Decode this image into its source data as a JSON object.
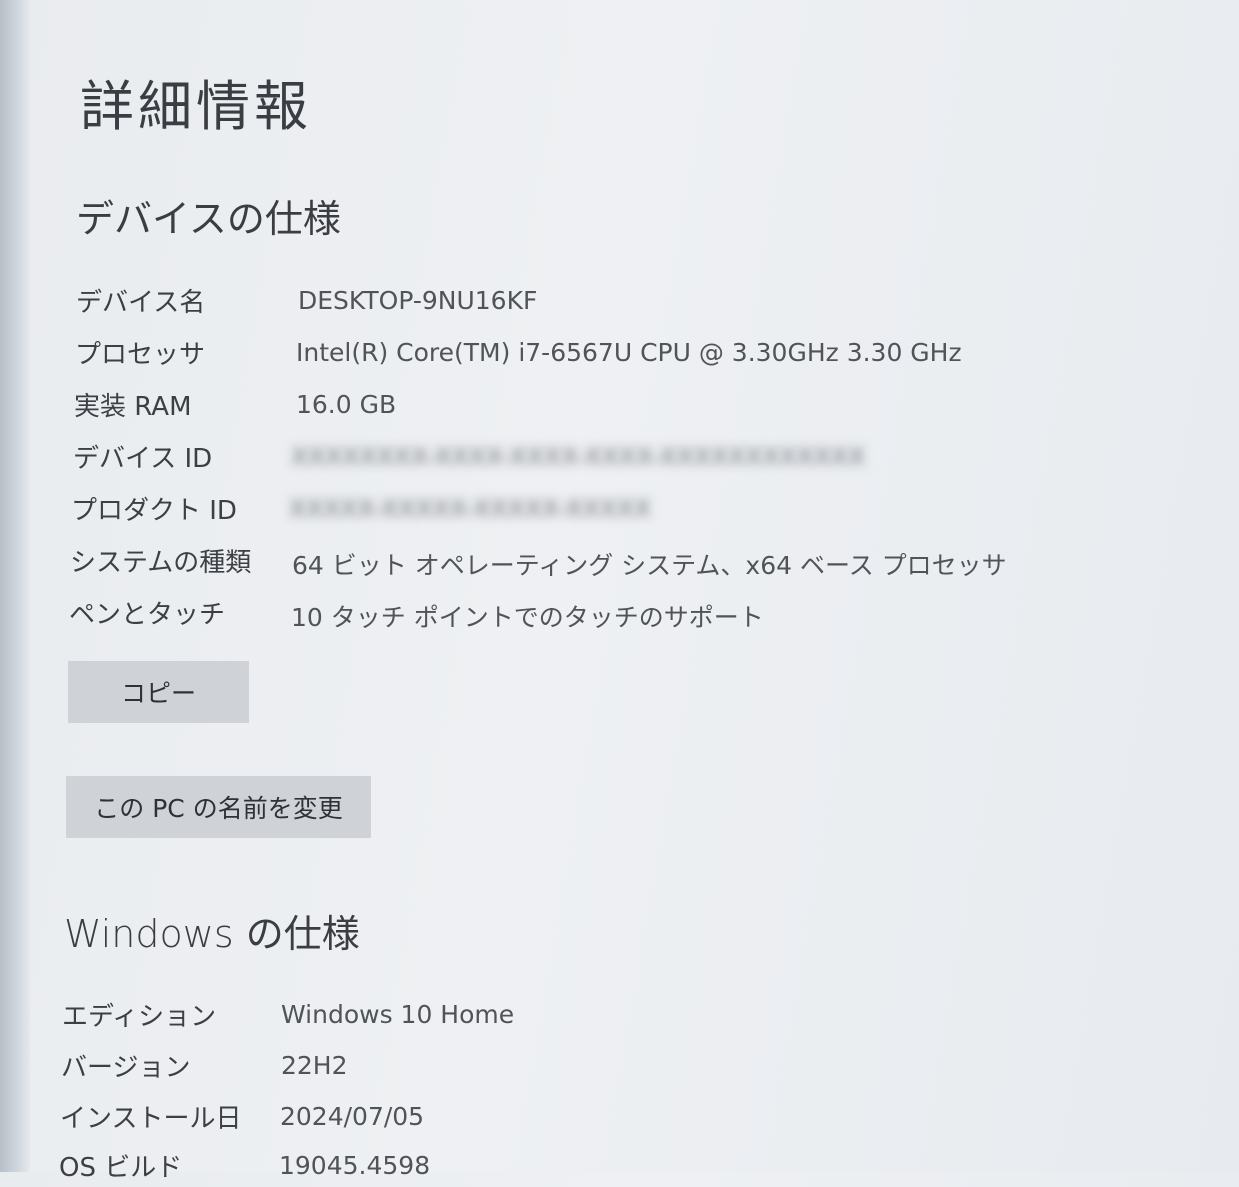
{
  "page": {
    "title": "詳細情報"
  },
  "device_specs": {
    "heading": "デバイスの仕様",
    "rows": [
      {
        "label": "デバイス名",
        "value": "DESKTOP-9NU16KF"
      },
      {
        "label": "プロセッサ",
        "value": "Intel(R) Core(TM) i7-6567U CPU @ 3.30GHz   3.30 GHz"
      },
      {
        "label": "実装 RAM",
        "value": "16.0 GB"
      },
      {
        "label": "デバイス ID",
        "value": "XXXXXXXX-XXXX-XXXX-XXXX-XXXXXXXXXXXX"
      },
      {
        "label": "プロダクト ID",
        "value": "XXXXX-XXXXX-XXXXX-XXXXX"
      },
      {
        "label": "システムの種類",
        "value": "64 ビット オペレーティング システム、x64 ベース プロセッサ"
      },
      {
        "label": "ペンとタッチ",
        "value": "10 タッチ ポイントでのタッチのサポート"
      }
    ],
    "copy_button": "コピー",
    "rename_button": "この PC の名前を変更"
  },
  "windows_specs": {
    "heading": "Windows の仕様",
    "rows": [
      {
        "label": "エディション",
        "value": "Windows 10 Home"
      },
      {
        "label": "バージョン",
        "value": "22H2"
      },
      {
        "label": "インストール日",
        "value": "2024/07/05"
      },
      {
        "label": "OS ビルド",
        "value": "19045.4598"
      }
    ]
  }
}
